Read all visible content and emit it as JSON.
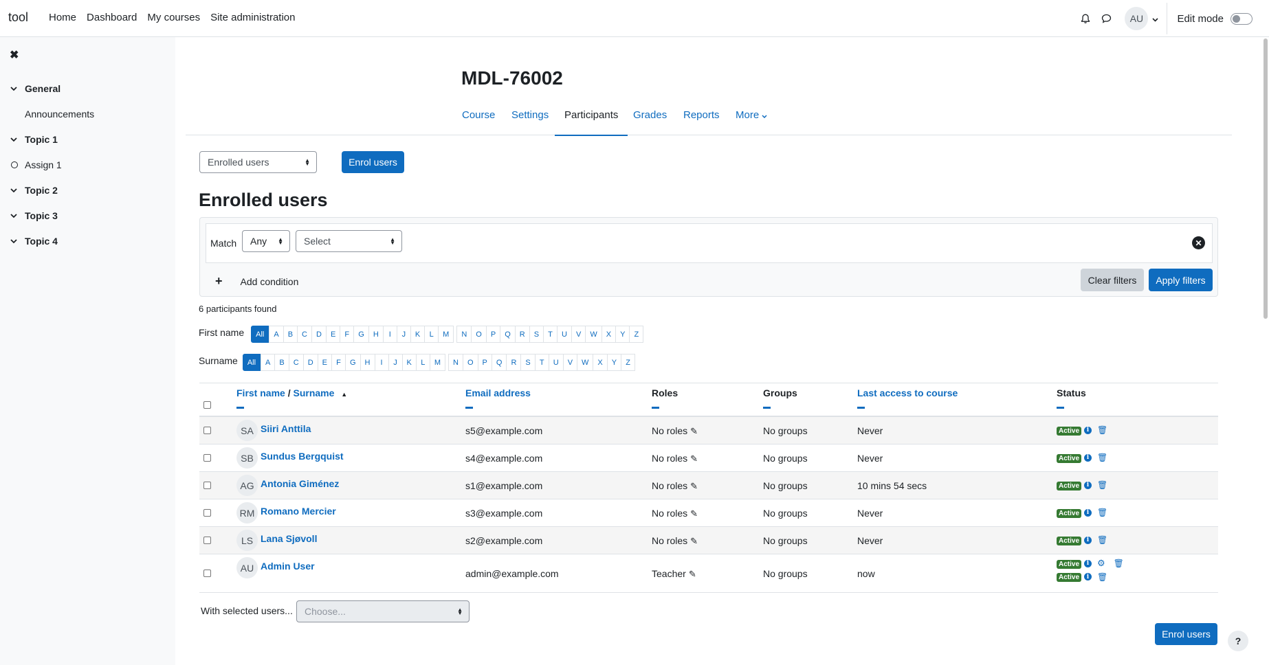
{
  "navbar": {
    "brand": "tool",
    "links": [
      "Home",
      "Dashboard",
      "My courses",
      "Site administration"
    ],
    "avatar_initials": "AU",
    "edit_mode_label": "Edit mode"
  },
  "drawer": {
    "sections": [
      {
        "title": "General",
        "items": [
          "Announcements"
        ]
      },
      {
        "title": "Topic 1",
        "items": [
          "Assign 1"
        ]
      },
      {
        "title": "Topic 2",
        "items": []
      },
      {
        "title": "Topic 3",
        "items": []
      },
      {
        "title": "Topic 4",
        "items": []
      }
    ]
  },
  "page": {
    "title": "MDL-76002",
    "tabs": [
      "Course",
      "Settings",
      "Participants",
      "Grades",
      "Reports",
      "More"
    ],
    "active_tab": "Participants",
    "view_select": "Enrolled users",
    "enrol_button": "Enrol users",
    "heading": "Enrolled users"
  },
  "filters": {
    "match_label": "Match",
    "match_value": "Any",
    "type_select": "Select",
    "add_condition": "Add condition",
    "clear_label": "Clear filters",
    "apply_label": "Apply filters"
  },
  "results": {
    "count_text": "6 participants found",
    "firstname_label": "First name",
    "surname_label": "Surname",
    "all_label": "All",
    "letters_a_m": [
      "A",
      "B",
      "C",
      "D",
      "E",
      "F",
      "G",
      "H",
      "I",
      "J",
      "K",
      "L",
      "M"
    ],
    "letters_n_z": [
      "N",
      "O",
      "P",
      "Q",
      "R",
      "S",
      "T",
      "U",
      "V",
      "W",
      "X",
      "Y",
      "Z"
    ]
  },
  "table": {
    "headers": {
      "firstname": "First name",
      "slash": " / ",
      "surname": "Surname",
      "email": "Email address",
      "roles": "Roles",
      "groups": "Groups",
      "last_access": "Last access to course",
      "status": "Status"
    },
    "rows": [
      {
        "initials": "SA",
        "name": "Siiri Anttila",
        "email": "s5@example.com",
        "roles": "No roles",
        "groups": "No groups",
        "last_access": "Never",
        "status": [
          "Active"
        ]
      },
      {
        "initials": "SB",
        "name": "Sundus Bergquist",
        "email": "s4@example.com",
        "roles": "No roles",
        "groups": "No groups",
        "last_access": "Never",
        "status": [
          "Active"
        ]
      },
      {
        "initials": "AG",
        "name": "Antonia Giménez",
        "email": "s1@example.com",
        "roles": "No roles",
        "groups": "No groups",
        "last_access": "10 mins 54 secs",
        "status": [
          "Active"
        ]
      },
      {
        "initials": "RM",
        "name": "Romano Mercier",
        "email": "s3@example.com",
        "roles": "No roles",
        "groups": "No groups",
        "last_access": "Never",
        "status": [
          "Active"
        ]
      },
      {
        "initials": "LS",
        "name": "Lana Sjøvoll",
        "email": "s2@example.com",
        "roles": "No roles",
        "groups": "No groups",
        "last_access": "Never",
        "status": [
          "Active"
        ]
      },
      {
        "initials": "AU",
        "name": "Admin User",
        "email": "admin@example.com",
        "roles": "Teacher",
        "groups": "No groups",
        "last_access": "now",
        "status": [
          "Active",
          "Active"
        ]
      }
    ]
  },
  "bulk": {
    "label": "With selected users...",
    "placeholder": "Choose...",
    "enrol_button": "Enrol users"
  },
  "help_label": "?",
  "colors": {
    "primary": "#0f6cbf",
    "active_badge": "#357a32"
  }
}
